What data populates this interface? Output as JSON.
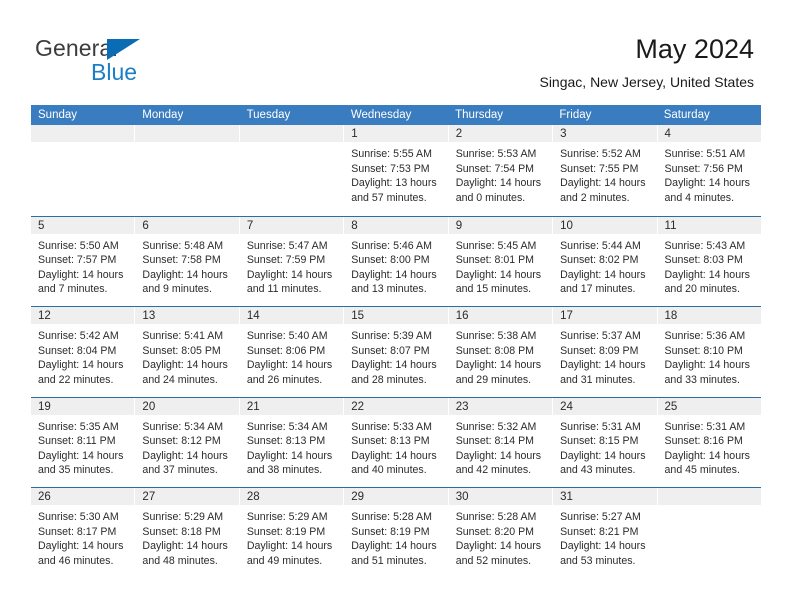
{
  "brand": {
    "line1": "General",
    "line2": "Blue",
    "mark": "triangle-logo"
  },
  "header": {
    "month_title": "May 2024",
    "location": "Singac, New Jersey, United States"
  },
  "colors": {
    "header_blue": "#3a7cc0",
    "row_divider_blue": "#2e6da4",
    "date_strip_gray": "#efefef",
    "brand_blue": "#1b7fc4"
  },
  "calendar": {
    "weekdays": [
      "Sunday",
      "Monday",
      "Tuesday",
      "Wednesday",
      "Thursday",
      "Friday",
      "Saturday"
    ],
    "labels": {
      "sunrise": "Sunrise:",
      "sunset": "Sunset:",
      "daylight": "Daylight:"
    },
    "weeks": [
      [
        {
          "day": "",
          "empty": true
        },
        {
          "day": "",
          "empty": true
        },
        {
          "day": "",
          "empty": true
        },
        {
          "day": "1",
          "sunrise": "Sunrise: 5:55 AM",
          "sunset": "Sunset: 7:53 PM",
          "daylight1": "Daylight: 13 hours",
          "daylight2": "and 57 minutes."
        },
        {
          "day": "2",
          "sunrise": "Sunrise: 5:53 AM",
          "sunset": "Sunset: 7:54 PM",
          "daylight1": "Daylight: 14 hours",
          "daylight2": "and 0 minutes."
        },
        {
          "day": "3",
          "sunrise": "Sunrise: 5:52 AM",
          "sunset": "Sunset: 7:55 PM",
          "daylight1": "Daylight: 14 hours",
          "daylight2": "and 2 minutes."
        },
        {
          "day": "4",
          "sunrise": "Sunrise: 5:51 AM",
          "sunset": "Sunset: 7:56 PM",
          "daylight1": "Daylight: 14 hours",
          "daylight2": "and 4 minutes."
        }
      ],
      [
        {
          "day": "5",
          "sunrise": "Sunrise: 5:50 AM",
          "sunset": "Sunset: 7:57 PM",
          "daylight1": "Daylight: 14 hours",
          "daylight2": "and 7 minutes."
        },
        {
          "day": "6",
          "sunrise": "Sunrise: 5:48 AM",
          "sunset": "Sunset: 7:58 PM",
          "daylight1": "Daylight: 14 hours",
          "daylight2": "and 9 minutes."
        },
        {
          "day": "7",
          "sunrise": "Sunrise: 5:47 AM",
          "sunset": "Sunset: 7:59 PM",
          "daylight1": "Daylight: 14 hours",
          "daylight2": "and 11 minutes."
        },
        {
          "day": "8",
          "sunrise": "Sunrise: 5:46 AM",
          "sunset": "Sunset: 8:00 PM",
          "daylight1": "Daylight: 14 hours",
          "daylight2": "and 13 minutes."
        },
        {
          "day": "9",
          "sunrise": "Sunrise: 5:45 AM",
          "sunset": "Sunset: 8:01 PM",
          "daylight1": "Daylight: 14 hours",
          "daylight2": "and 15 minutes."
        },
        {
          "day": "10",
          "sunrise": "Sunrise: 5:44 AM",
          "sunset": "Sunset: 8:02 PM",
          "daylight1": "Daylight: 14 hours",
          "daylight2": "and 17 minutes."
        },
        {
          "day": "11",
          "sunrise": "Sunrise: 5:43 AM",
          "sunset": "Sunset: 8:03 PM",
          "daylight1": "Daylight: 14 hours",
          "daylight2": "and 20 minutes."
        }
      ],
      [
        {
          "day": "12",
          "sunrise": "Sunrise: 5:42 AM",
          "sunset": "Sunset: 8:04 PM",
          "daylight1": "Daylight: 14 hours",
          "daylight2": "and 22 minutes."
        },
        {
          "day": "13",
          "sunrise": "Sunrise: 5:41 AM",
          "sunset": "Sunset: 8:05 PM",
          "daylight1": "Daylight: 14 hours",
          "daylight2": "and 24 minutes."
        },
        {
          "day": "14",
          "sunrise": "Sunrise: 5:40 AM",
          "sunset": "Sunset: 8:06 PM",
          "daylight1": "Daylight: 14 hours",
          "daylight2": "and 26 minutes."
        },
        {
          "day": "15",
          "sunrise": "Sunrise: 5:39 AM",
          "sunset": "Sunset: 8:07 PM",
          "daylight1": "Daylight: 14 hours",
          "daylight2": "and 28 minutes."
        },
        {
          "day": "16",
          "sunrise": "Sunrise: 5:38 AM",
          "sunset": "Sunset: 8:08 PM",
          "daylight1": "Daylight: 14 hours",
          "daylight2": "and 29 minutes."
        },
        {
          "day": "17",
          "sunrise": "Sunrise: 5:37 AM",
          "sunset": "Sunset: 8:09 PM",
          "daylight1": "Daylight: 14 hours",
          "daylight2": "and 31 minutes."
        },
        {
          "day": "18",
          "sunrise": "Sunrise: 5:36 AM",
          "sunset": "Sunset: 8:10 PM",
          "daylight1": "Daylight: 14 hours",
          "daylight2": "and 33 minutes."
        }
      ],
      [
        {
          "day": "19",
          "sunrise": "Sunrise: 5:35 AM",
          "sunset": "Sunset: 8:11 PM",
          "daylight1": "Daylight: 14 hours",
          "daylight2": "and 35 minutes."
        },
        {
          "day": "20",
          "sunrise": "Sunrise: 5:34 AM",
          "sunset": "Sunset: 8:12 PM",
          "daylight1": "Daylight: 14 hours",
          "daylight2": "and 37 minutes."
        },
        {
          "day": "21",
          "sunrise": "Sunrise: 5:34 AM",
          "sunset": "Sunset: 8:13 PM",
          "daylight1": "Daylight: 14 hours",
          "daylight2": "and 38 minutes."
        },
        {
          "day": "22",
          "sunrise": "Sunrise: 5:33 AM",
          "sunset": "Sunset: 8:13 PM",
          "daylight1": "Daylight: 14 hours",
          "daylight2": "and 40 minutes."
        },
        {
          "day": "23",
          "sunrise": "Sunrise: 5:32 AM",
          "sunset": "Sunset: 8:14 PM",
          "daylight1": "Daylight: 14 hours",
          "daylight2": "and 42 minutes."
        },
        {
          "day": "24",
          "sunrise": "Sunrise: 5:31 AM",
          "sunset": "Sunset: 8:15 PM",
          "daylight1": "Daylight: 14 hours",
          "daylight2": "and 43 minutes."
        },
        {
          "day": "25",
          "sunrise": "Sunrise: 5:31 AM",
          "sunset": "Sunset: 8:16 PM",
          "daylight1": "Daylight: 14 hours",
          "daylight2": "and 45 minutes."
        }
      ],
      [
        {
          "day": "26",
          "sunrise": "Sunrise: 5:30 AM",
          "sunset": "Sunset: 8:17 PM",
          "daylight1": "Daylight: 14 hours",
          "daylight2": "and 46 minutes."
        },
        {
          "day": "27",
          "sunrise": "Sunrise: 5:29 AM",
          "sunset": "Sunset: 8:18 PM",
          "daylight1": "Daylight: 14 hours",
          "daylight2": "and 48 minutes."
        },
        {
          "day": "28",
          "sunrise": "Sunrise: 5:29 AM",
          "sunset": "Sunset: 8:19 PM",
          "daylight1": "Daylight: 14 hours",
          "daylight2": "and 49 minutes."
        },
        {
          "day": "29",
          "sunrise": "Sunrise: 5:28 AM",
          "sunset": "Sunset: 8:19 PM",
          "daylight1": "Daylight: 14 hours",
          "daylight2": "and 51 minutes."
        },
        {
          "day": "30",
          "sunrise": "Sunrise: 5:28 AM",
          "sunset": "Sunset: 8:20 PM",
          "daylight1": "Daylight: 14 hours",
          "daylight2": "and 52 minutes."
        },
        {
          "day": "31",
          "sunrise": "Sunrise: 5:27 AM",
          "sunset": "Sunset: 8:21 PM",
          "daylight1": "Daylight: 14 hours",
          "daylight2": "and 53 minutes."
        },
        {
          "day": "",
          "empty": true
        }
      ]
    ]
  }
}
